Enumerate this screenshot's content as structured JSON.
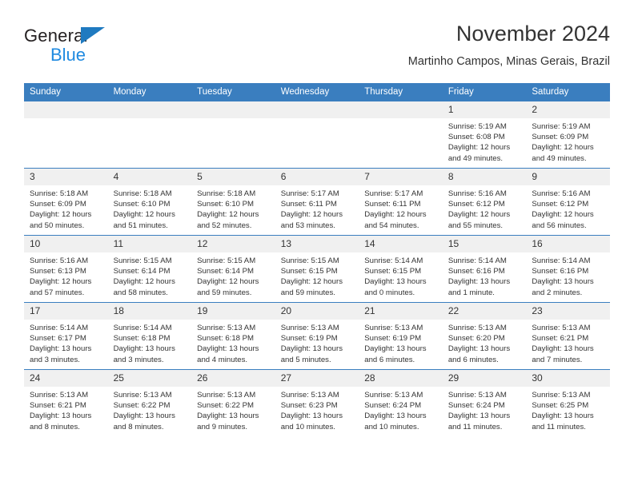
{
  "brand": {
    "name_top": "General",
    "name_bottom": "Blue",
    "accent_color": "#1f8ae0",
    "triangle_color": "#1f7ac0"
  },
  "header": {
    "title": "November 2024",
    "subtitle": "Martinho Campos, Minas Gerais, Brazil",
    "header_bg": "#3a7ebf",
    "daynum_bg": "#f0f0f0"
  },
  "weekdays": [
    "Sunday",
    "Monday",
    "Tuesday",
    "Wednesday",
    "Thursday",
    "Friday",
    "Saturday"
  ],
  "weeks": [
    [
      {
        "day": "",
        "lines": []
      },
      {
        "day": "",
        "lines": []
      },
      {
        "day": "",
        "lines": []
      },
      {
        "day": "",
        "lines": []
      },
      {
        "day": "",
        "lines": []
      },
      {
        "day": "1",
        "lines": [
          "Sunrise: 5:19 AM",
          "Sunset: 6:08 PM",
          "Daylight: 12 hours",
          "and 49 minutes."
        ]
      },
      {
        "day": "2",
        "lines": [
          "Sunrise: 5:19 AM",
          "Sunset: 6:09 PM",
          "Daylight: 12 hours",
          "and 49 minutes."
        ]
      }
    ],
    [
      {
        "day": "3",
        "lines": [
          "Sunrise: 5:18 AM",
          "Sunset: 6:09 PM",
          "Daylight: 12 hours",
          "and 50 minutes."
        ]
      },
      {
        "day": "4",
        "lines": [
          "Sunrise: 5:18 AM",
          "Sunset: 6:10 PM",
          "Daylight: 12 hours",
          "and 51 minutes."
        ]
      },
      {
        "day": "5",
        "lines": [
          "Sunrise: 5:18 AM",
          "Sunset: 6:10 PM",
          "Daylight: 12 hours",
          "and 52 minutes."
        ]
      },
      {
        "day": "6",
        "lines": [
          "Sunrise: 5:17 AM",
          "Sunset: 6:11 PM",
          "Daylight: 12 hours",
          "and 53 minutes."
        ]
      },
      {
        "day": "7",
        "lines": [
          "Sunrise: 5:17 AM",
          "Sunset: 6:11 PM",
          "Daylight: 12 hours",
          "and 54 minutes."
        ]
      },
      {
        "day": "8",
        "lines": [
          "Sunrise: 5:16 AM",
          "Sunset: 6:12 PM",
          "Daylight: 12 hours",
          "and 55 minutes."
        ]
      },
      {
        "day": "9",
        "lines": [
          "Sunrise: 5:16 AM",
          "Sunset: 6:12 PM",
          "Daylight: 12 hours",
          "and 56 minutes."
        ]
      }
    ],
    [
      {
        "day": "10",
        "lines": [
          "Sunrise: 5:16 AM",
          "Sunset: 6:13 PM",
          "Daylight: 12 hours",
          "and 57 minutes."
        ]
      },
      {
        "day": "11",
        "lines": [
          "Sunrise: 5:15 AM",
          "Sunset: 6:14 PM",
          "Daylight: 12 hours",
          "and 58 minutes."
        ]
      },
      {
        "day": "12",
        "lines": [
          "Sunrise: 5:15 AM",
          "Sunset: 6:14 PM",
          "Daylight: 12 hours",
          "and 59 minutes."
        ]
      },
      {
        "day": "13",
        "lines": [
          "Sunrise: 5:15 AM",
          "Sunset: 6:15 PM",
          "Daylight: 12 hours",
          "and 59 minutes."
        ]
      },
      {
        "day": "14",
        "lines": [
          "Sunrise: 5:14 AM",
          "Sunset: 6:15 PM",
          "Daylight: 13 hours",
          "and 0 minutes."
        ]
      },
      {
        "day": "15",
        "lines": [
          "Sunrise: 5:14 AM",
          "Sunset: 6:16 PM",
          "Daylight: 13 hours",
          "and 1 minute."
        ]
      },
      {
        "day": "16",
        "lines": [
          "Sunrise: 5:14 AM",
          "Sunset: 6:16 PM",
          "Daylight: 13 hours",
          "and 2 minutes."
        ]
      }
    ],
    [
      {
        "day": "17",
        "lines": [
          "Sunrise: 5:14 AM",
          "Sunset: 6:17 PM",
          "Daylight: 13 hours",
          "and 3 minutes."
        ]
      },
      {
        "day": "18",
        "lines": [
          "Sunrise: 5:14 AM",
          "Sunset: 6:18 PM",
          "Daylight: 13 hours",
          "and 3 minutes."
        ]
      },
      {
        "day": "19",
        "lines": [
          "Sunrise: 5:13 AM",
          "Sunset: 6:18 PM",
          "Daylight: 13 hours",
          "and 4 minutes."
        ]
      },
      {
        "day": "20",
        "lines": [
          "Sunrise: 5:13 AM",
          "Sunset: 6:19 PM",
          "Daylight: 13 hours",
          "and 5 minutes."
        ]
      },
      {
        "day": "21",
        "lines": [
          "Sunrise: 5:13 AM",
          "Sunset: 6:19 PM",
          "Daylight: 13 hours",
          "and 6 minutes."
        ]
      },
      {
        "day": "22",
        "lines": [
          "Sunrise: 5:13 AM",
          "Sunset: 6:20 PM",
          "Daylight: 13 hours",
          "and 6 minutes."
        ]
      },
      {
        "day": "23",
        "lines": [
          "Sunrise: 5:13 AM",
          "Sunset: 6:21 PM",
          "Daylight: 13 hours",
          "and 7 minutes."
        ]
      }
    ],
    [
      {
        "day": "24",
        "lines": [
          "Sunrise: 5:13 AM",
          "Sunset: 6:21 PM",
          "Daylight: 13 hours",
          "and 8 minutes."
        ]
      },
      {
        "day": "25",
        "lines": [
          "Sunrise: 5:13 AM",
          "Sunset: 6:22 PM",
          "Daylight: 13 hours",
          "and 8 minutes."
        ]
      },
      {
        "day": "26",
        "lines": [
          "Sunrise: 5:13 AM",
          "Sunset: 6:22 PM",
          "Daylight: 13 hours",
          "and 9 minutes."
        ]
      },
      {
        "day": "27",
        "lines": [
          "Sunrise: 5:13 AM",
          "Sunset: 6:23 PM",
          "Daylight: 13 hours",
          "and 10 minutes."
        ]
      },
      {
        "day": "28",
        "lines": [
          "Sunrise: 5:13 AM",
          "Sunset: 6:24 PM",
          "Daylight: 13 hours",
          "and 10 minutes."
        ]
      },
      {
        "day": "29",
        "lines": [
          "Sunrise: 5:13 AM",
          "Sunset: 6:24 PM",
          "Daylight: 13 hours",
          "and 11 minutes."
        ]
      },
      {
        "day": "30",
        "lines": [
          "Sunrise: 5:13 AM",
          "Sunset: 6:25 PM",
          "Daylight: 13 hours",
          "and 11 minutes."
        ]
      }
    ]
  ]
}
